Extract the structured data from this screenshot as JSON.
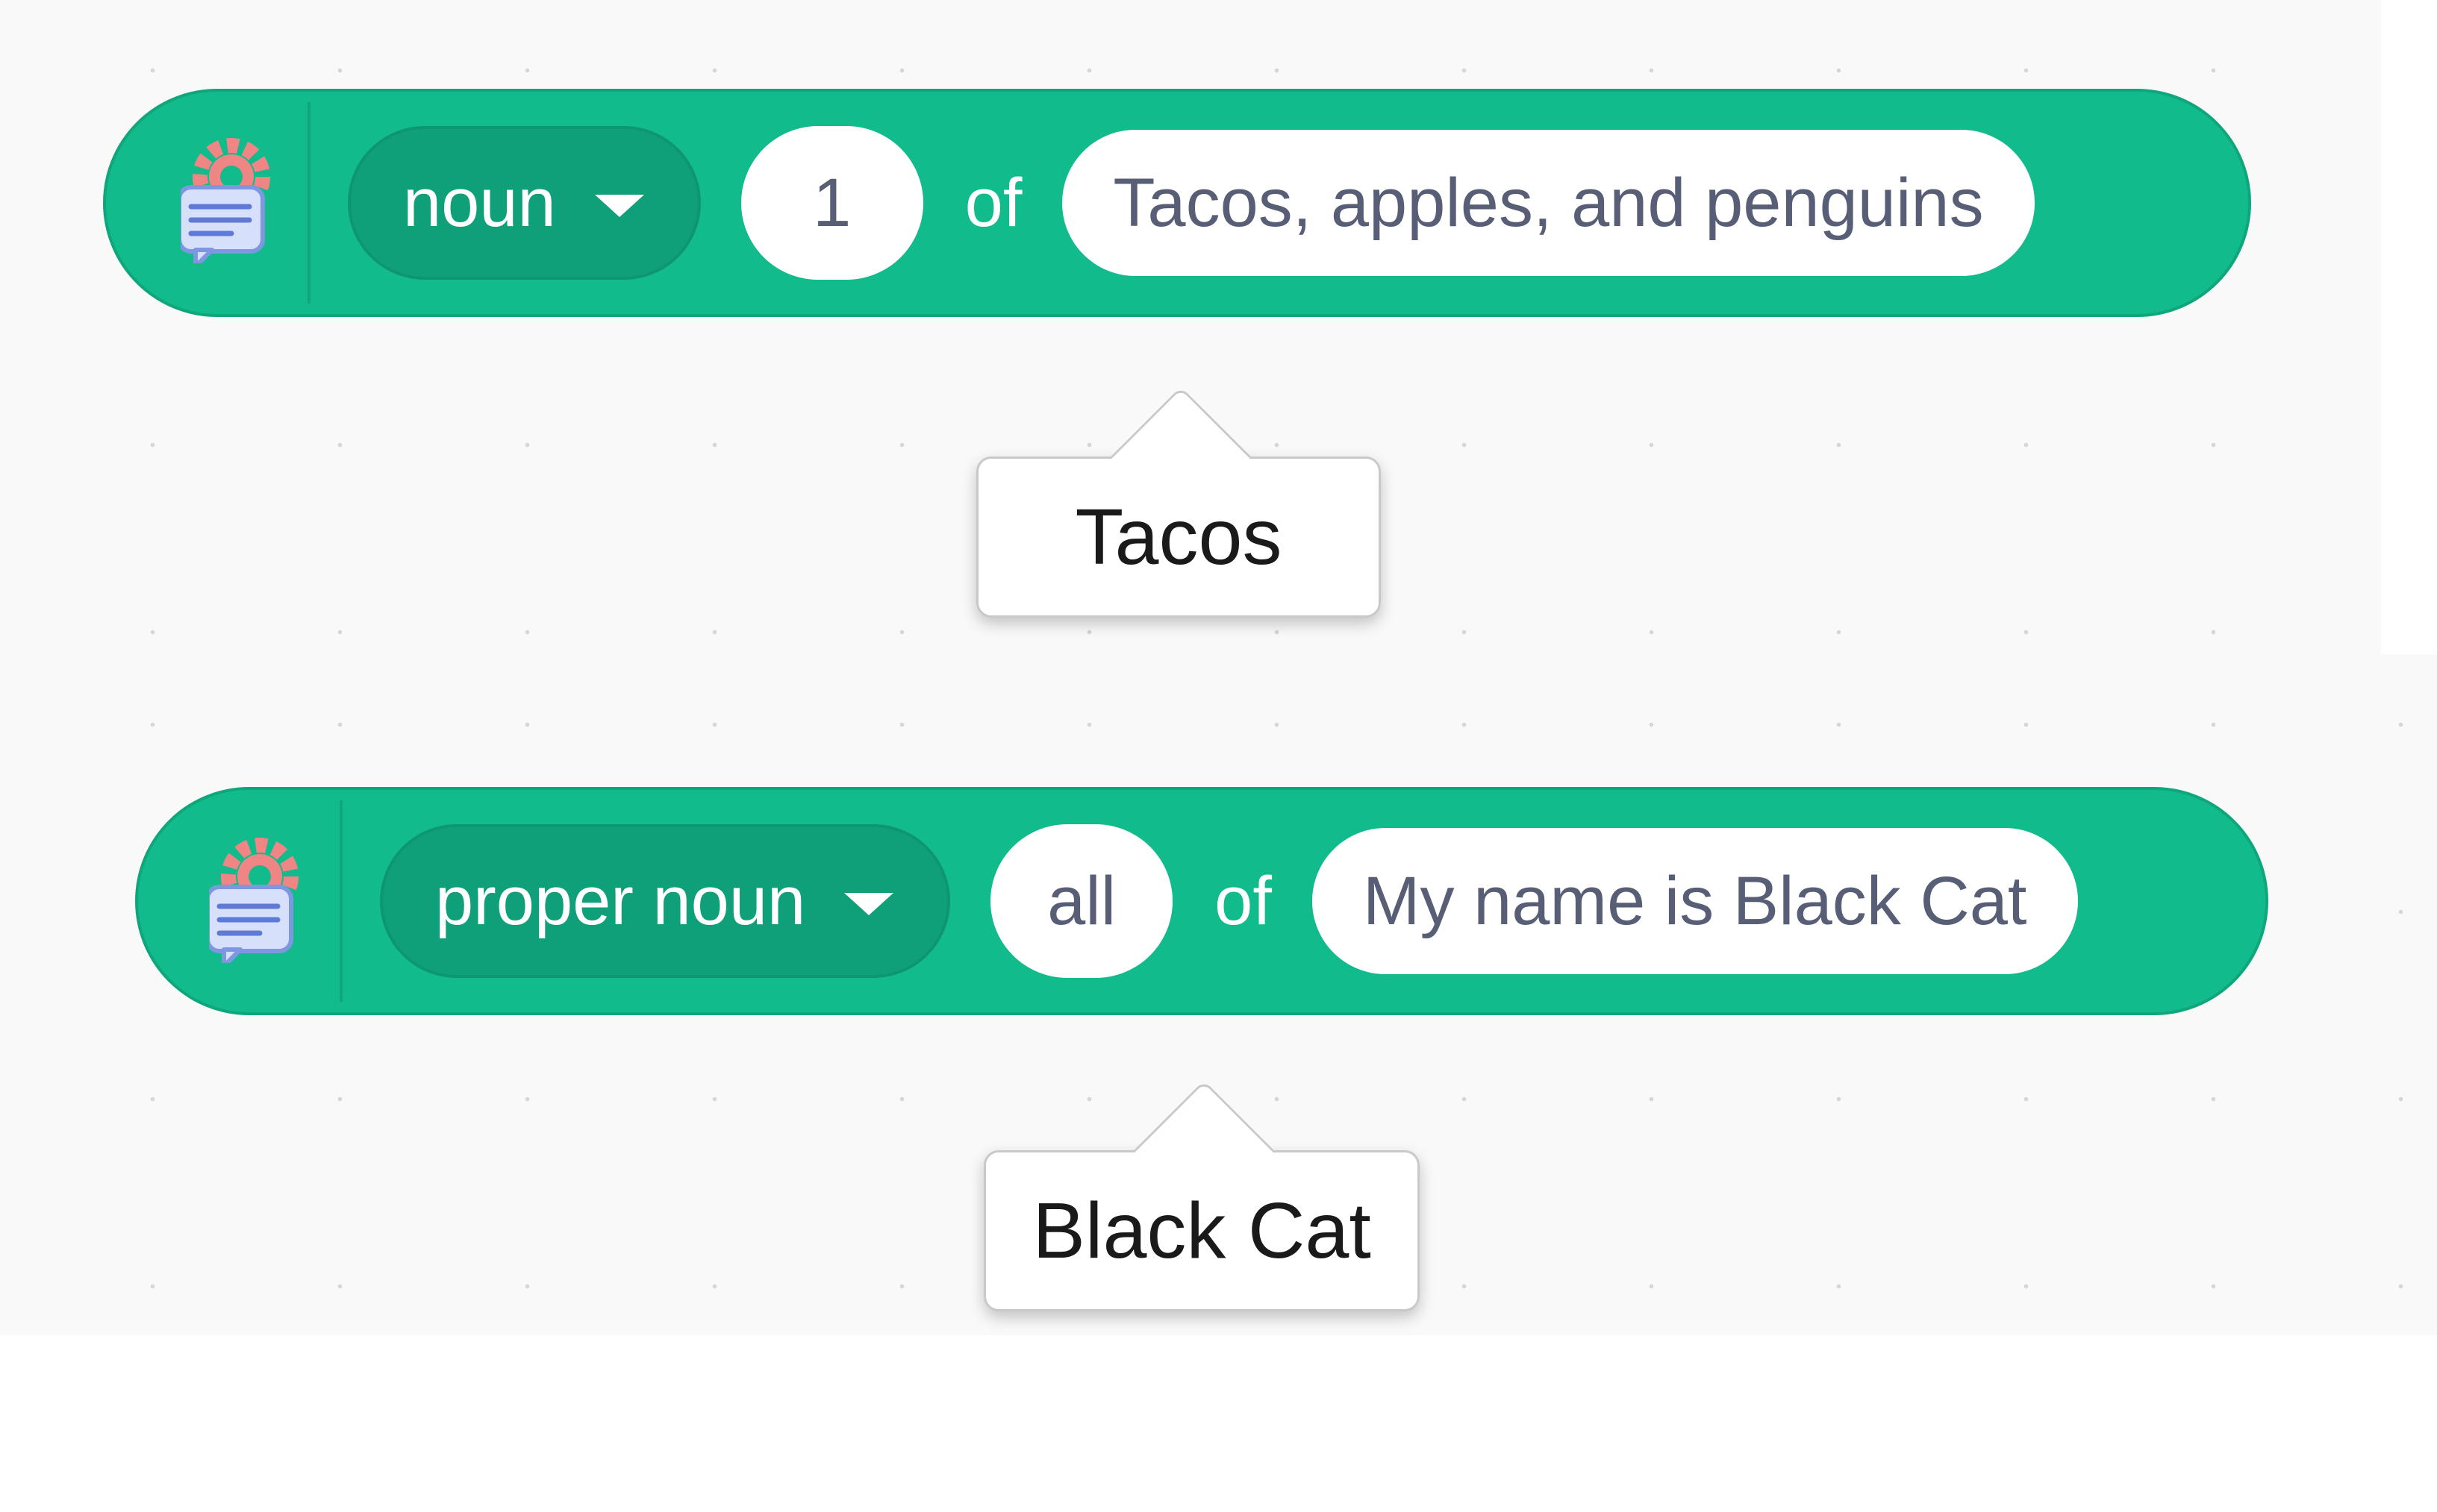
{
  "blocks": [
    {
      "icon": "text-processing-extension-icon",
      "dropdown_value": "noun",
      "index_value": "1",
      "of_label": "of",
      "text_value": "Tacos, apples, and penguins",
      "report": "Tacos"
    },
    {
      "icon": "text-processing-extension-icon",
      "dropdown_value": "proper noun",
      "index_value": "all",
      "of_label": "of",
      "text_value": "My name is Black Cat",
      "report": "Black Cat"
    }
  ],
  "colors": {
    "block": "#12bb8b",
    "dropdown": "#0fa07a",
    "input_text": "#575e75",
    "icon_bubble": "#d6e0fb",
    "icon_gear": "#f08585"
  }
}
